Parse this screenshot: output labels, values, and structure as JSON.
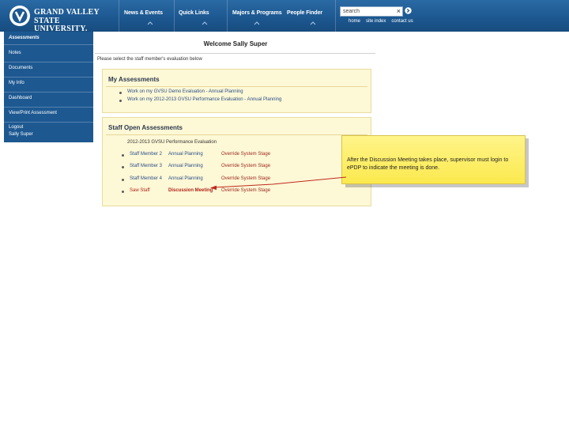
{
  "header": {
    "logo": {
      "line1": "GRAND VALLEY",
      "line2": "STATE UNIVERSITY."
    },
    "nav": [
      {
        "label": "News & Events"
      },
      {
        "label": "Quick Links"
      },
      {
        "label": "Majors & Programs"
      },
      {
        "label": "People Finder"
      }
    ],
    "search": {
      "value": "search",
      "clear": "×"
    },
    "util_links": [
      "home",
      "site index",
      "contact us"
    ]
  },
  "sidebar": {
    "heading": "Assessments",
    "items": [
      "Notes",
      "Documents",
      "My Info",
      "Dashboard",
      "View/Print Assessment"
    ],
    "logout": {
      "label": "Logout",
      "user": "Sally Super"
    }
  },
  "main": {
    "title": "Welcome Sally Super",
    "instruction": "Please select the staff member's evaluation below",
    "my_assessments": {
      "title": "My Assessments",
      "items": [
        "Work on my GVSU Demo Evaluation - Annual Planning",
        "Work on my 2012-2013 GVSU Performance Evaluation - Annual Planning"
      ]
    },
    "staff_open": {
      "title": "Staff Open Assessments",
      "group": "2012-2013 GVSU Performance Evaluation",
      "rows": [
        {
          "name": "Staff Member 2",
          "stage": "Annual Planning",
          "action": "Override System Stage"
        },
        {
          "name": "Staff Member 3",
          "stage": "Annual Planning",
          "action": "Override System Stage"
        },
        {
          "name": "Staff Member 4",
          "stage": "Annual Planning",
          "action": "Override System Stage"
        },
        {
          "name": "Saw Staff",
          "stage": "Discussion Meeting",
          "action": "Override System Stage"
        }
      ]
    }
  },
  "callout": {
    "text": "After the Discussion Meeting takes place, supervisor must login to ePDP to indicate the meeting is done."
  },
  "colors": {
    "header_blue": "#1d5891",
    "panel_yellow": "#fdf8d6",
    "callout_yellow": "#fbe94e",
    "active_red": "#b0241b"
  }
}
